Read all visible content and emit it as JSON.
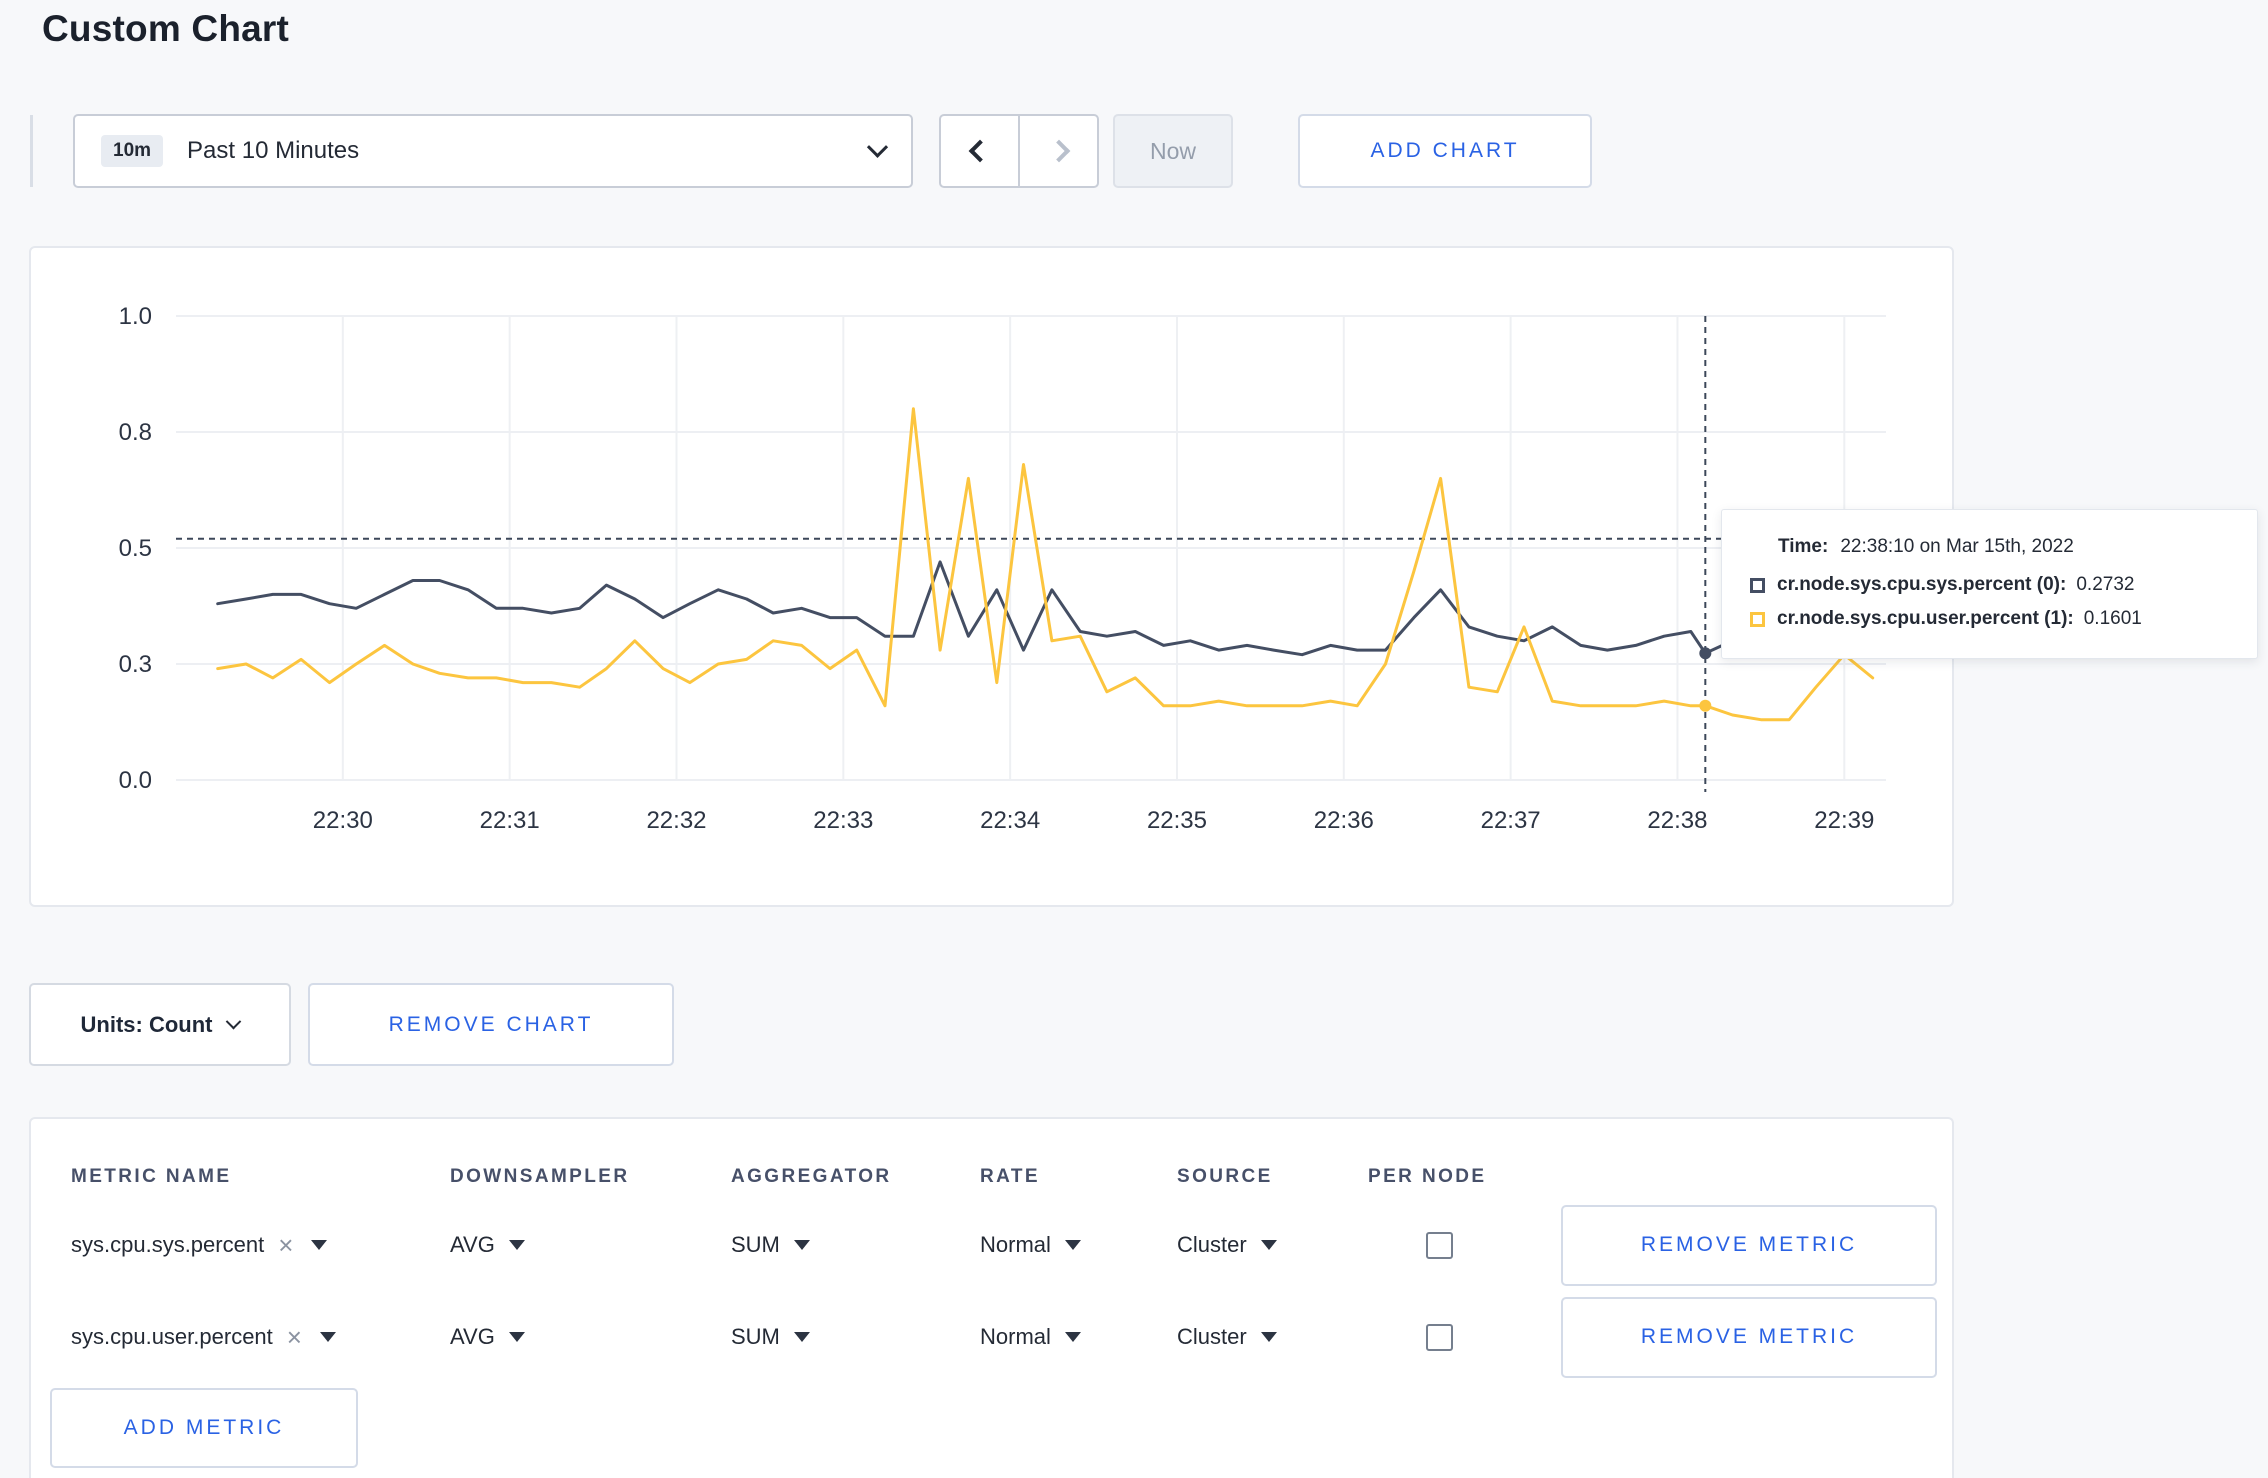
{
  "page": {
    "title": "Custom Chart"
  },
  "colors": {
    "accent_blue": "#2a62e4",
    "series_sys": "#444e63",
    "series_user": "#fcc53f"
  },
  "icons": {
    "close": "×"
  },
  "toolbar": {
    "time_range": {
      "badge": "10m",
      "label": "Past 10 Minutes"
    },
    "now_label": "Now",
    "add_chart_label": "ADD CHART"
  },
  "chart_data": {
    "type": "line",
    "x_domain": [
      -1.0,
      9.25
    ],
    "y_domain": [
      0,
      1
    ],
    "x_ticks": [
      {
        "t": 0,
        "label": "22:30"
      },
      {
        "t": 1,
        "label": "22:31"
      },
      {
        "t": 2,
        "label": "22:32"
      },
      {
        "t": 3,
        "label": "22:33"
      },
      {
        "t": 4,
        "label": "22:34"
      },
      {
        "t": 5,
        "label": "22:35"
      },
      {
        "t": 6,
        "label": "22:36"
      },
      {
        "t": 7,
        "label": "22:37"
      },
      {
        "t": 8,
        "label": "22:38"
      },
      {
        "t": 9,
        "label": "22:39"
      }
    ],
    "y_ticks": [
      {
        "v": 0.0,
        "label": "0.0"
      },
      {
        "v": 0.25,
        "label": "0.3"
      },
      {
        "v": 0.5,
        "label": "0.5"
      },
      {
        "v": 0.75,
        "label": "0.8"
      },
      {
        "v": 1.0,
        "label": "1.0"
      }
    ],
    "crosshair": {
      "t": 8.167,
      "v": 0.52
    },
    "series": [
      {
        "name": "cr.node.sys.cpu.sys.percent",
        "color": "#444e63",
        "marker": [
          8.167,
          0.2732
        ],
        "points": [
          [
            -0.75,
            0.38
          ],
          [
            -0.58,
            0.39
          ],
          [
            -0.42,
            0.4
          ],
          [
            -0.25,
            0.4
          ],
          [
            -0.08,
            0.38
          ],
          [
            0.08,
            0.37
          ],
          [
            0.25,
            0.4
          ],
          [
            0.42,
            0.43
          ],
          [
            0.58,
            0.43
          ],
          [
            0.75,
            0.41
          ],
          [
            0.92,
            0.37
          ],
          [
            1.08,
            0.37
          ],
          [
            1.25,
            0.36
          ],
          [
            1.42,
            0.37
          ],
          [
            1.58,
            0.42
          ],
          [
            1.75,
            0.39
          ],
          [
            1.92,
            0.35
          ],
          [
            2.08,
            0.38
          ],
          [
            2.25,
            0.41
          ],
          [
            2.42,
            0.39
          ],
          [
            2.58,
            0.36
          ],
          [
            2.75,
            0.37
          ],
          [
            2.92,
            0.35
          ],
          [
            3.08,
            0.35
          ],
          [
            3.25,
            0.31
          ],
          [
            3.42,
            0.31
          ],
          [
            3.58,
            0.47
          ],
          [
            3.75,
            0.31
          ],
          [
            3.92,
            0.41
          ],
          [
            4.08,
            0.28
          ],
          [
            4.25,
            0.41
          ],
          [
            4.42,
            0.32
          ],
          [
            4.58,
            0.31
          ],
          [
            4.75,
            0.32
          ],
          [
            4.92,
            0.29
          ],
          [
            5.08,
            0.3
          ],
          [
            5.25,
            0.28
          ],
          [
            5.42,
            0.29
          ],
          [
            5.58,
            0.28
          ],
          [
            5.75,
            0.27
          ],
          [
            5.92,
            0.29
          ],
          [
            6.08,
            0.28
          ],
          [
            6.25,
            0.28
          ],
          [
            6.42,
            0.35
          ],
          [
            6.58,
            0.41
          ],
          [
            6.75,
            0.33
          ],
          [
            6.92,
            0.31
          ],
          [
            7.08,
            0.3
          ],
          [
            7.25,
            0.33
          ],
          [
            7.42,
            0.29
          ],
          [
            7.58,
            0.28
          ],
          [
            7.75,
            0.29
          ],
          [
            7.92,
            0.31
          ],
          [
            8.08,
            0.32
          ],
          [
            8.167,
            0.2732
          ],
          [
            8.33,
            0.3
          ],
          [
            8.5,
            0.3
          ],
          [
            8.67,
            0.3
          ],
          [
            8.83,
            0.31
          ],
          [
            9.0,
            0.3
          ],
          [
            9.17,
            0.31
          ]
        ]
      },
      {
        "name": "cr.node.sys.cpu.user.percent",
        "color": "#fcc53f",
        "marker": [
          8.167,
          0.1601
        ],
        "points": [
          [
            -0.75,
            0.24
          ],
          [
            -0.58,
            0.25
          ],
          [
            -0.42,
            0.22
          ],
          [
            -0.25,
            0.26
          ],
          [
            -0.08,
            0.21
          ],
          [
            0.08,
            0.25
          ],
          [
            0.25,
            0.29
          ],
          [
            0.42,
            0.25
          ],
          [
            0.58,
            0.23
          ],
          [
            0.75,
            0.22
          ],
          [
            0.92,
            0.22
          ],
          [
            1.08,
            0.21
          ],
          [
            1.25,
            0.21
          ],
          [
            1.42,
            0.2
          ],
          [
            1.58,
            0.24
          ],
          [
            1.75,
            0.3
          ],
          [
            1.92,
            0.24
          ],
          [
            2.08,
            0.21
          ],
          [
            2.25,
            0.25
          ],
          [
            2.42,
            0.26
          ],
          [
            2.58,
            0.3
          ],
          [
            2.75,
            0.29
          ],
          [
            2.92,
            0.24
          ],
          [
            3.08,
            0.28
          ],
          [
            3.25,
            0.16
          ],
          [
            3.42,
            0.8
          ],
          [
            3.58,
            0.28
          ],
          [
            3.75,
            0.65
          ],
          [
            3.92,
            0.21
          ],
          [
            4.08,
            0.68
          ],
          [
            4.25,
            0.3
          ],
          [
            4.42,
            0.31
          ],
          [
            4.58,
            0.19
          ],
          [
            4.75,
            0.22
          ],
          [
            4.92,
            0.16
          ],
          [
            5.08,
            0.16
          ],
          [
            5.25,
            0.17
          ],
          [
            5.42,
            0.16
          ],
          [
            5.58,
            0.16
          ],
          [
            5.75,
            0.16
          ],
          [
            5.92,
            0.17
          ],
          [
            6.08,
            0.16
          ],
          [
            6.25,
            0.25
          ],
          [
            6.42,
            0.45
          ],
          [
            6.58,
            0.65
          ],
          [
            6.75,
            0.2
          ],
          [
            6.92,
            0.19
          ],
          [
            7.08,
            0.33
          ],
          [
            7.25,
            0.17
          ],
          [
            7.42,
            0.16
          ],
          [
            7.58,
            0.16
          ],
          [
            7.75,
            0.16
          ],
          [
            7.92,
            0.17
          ],
          [
            8.08,
            0.16
          ],
          [
            8.167,
            0.1601
          ],
          [
            8.33,
            0.14
          ],
          [
            8.5,
            0.13
          ],
          [
            8.67,
            0.13
          ],
          [
            8.83,
            0.2
          ],
          [
            9.0,
            0.27
          ],
          [
            9.17,
            0.22
          ]
        ]
      }
    ]
  },
  "tooltip": {
    "time_label": "Time:",
    "time_value": "22:38:10 on Mar 15th, 2022",
    "rows": [
      {
        "label": "cr.node.sys.cpu.sys.percent (0):",
        "value": "0.2732"
      },
      {
        "label": "cr.node.sys.cpu.user.percent (1):",
        "value": "0.1601"
      }
    ]
  },
  "units": {
    "label": "Units: Count",
    "remove_chart_label": "REMOVE CHART"
  },
  "metrics_table": {
    "headers": [
      "METRIC NAME",
      "DOWNSAMPLER",
      "AGGREGATOR",
      "RATE",
      "SOURCE",
      "PER NODE"
    ],
    "rows": [
      {
        "metric": "sys.cpu.sys.percent",
        "downsampler": "AVG",
        "aggregator": "SUM",
        "rate": "Normal",
        "source": "Cluster",
        "per_node": false,
        "remove_label": "REMOVE METRIC"
      },
      {
        "metric": "sys.cpu.user.percent",
        "downsampler": "AVG",
        "aggregator": "SUM",
        "rate": "Normal",
        "source": "Cluster",
        "per_node": false,
        "remove_label": "REMOVE METRIC"
      }
    ],
    "add_metric_label": "ADD METRIC"
  }
}
